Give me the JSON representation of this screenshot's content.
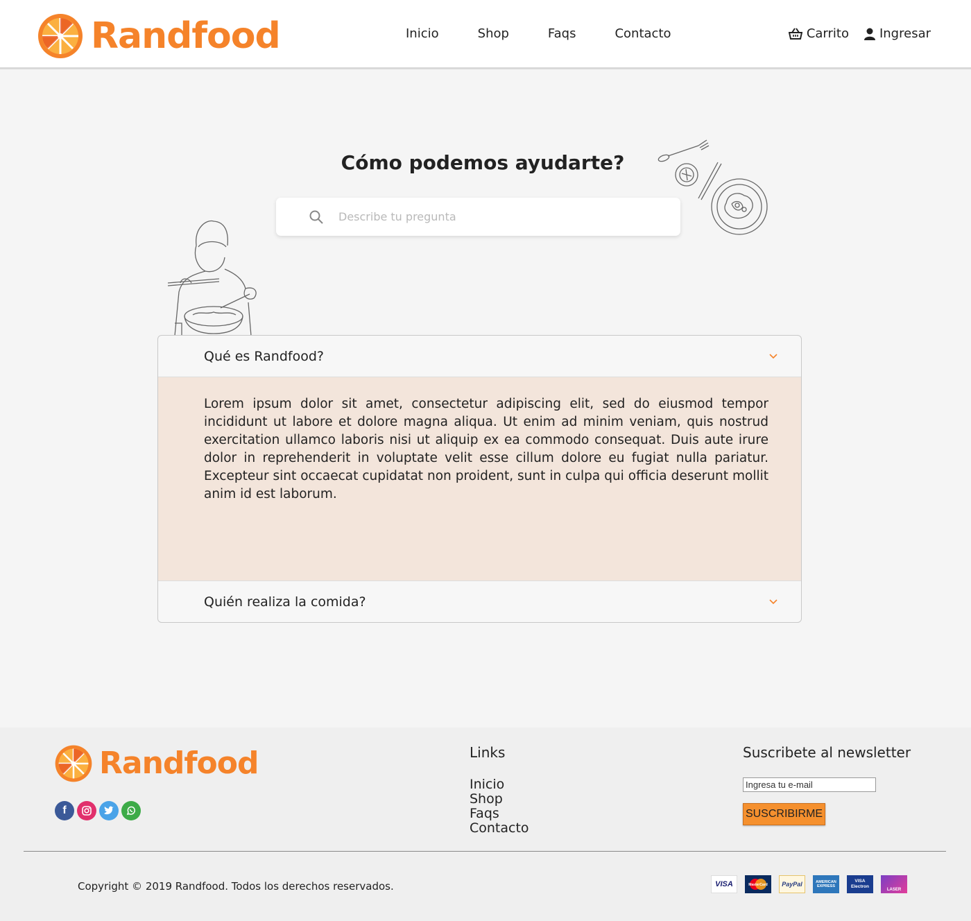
{
  "brand": {
    "name": "Randfood",
    "orange": "#f5832a"
  },
  "nav": {
    "items": [
      "Inicio",
      "Shop",
      "Faqs",
      "Contacto"
    ]
  },
  "header": {
    "cart_label": "Carrito",
    "login_label": "Ingresar"
  },
  "hero": {
    "title": "Cómo podemos ayudarte?",
    "search_placeholder": "Describe tu pregunta"
  },
  "faq": {
    "items": [
      {
        "question": "Qué es Randfood?",
        "answer": "Lorem ipsum dolor sit amet, consectetur adipiscing elit, sed do eiusmod tempor incididunt ut labore et dolore magna aliqua. Ut enim ad minim veniam, quis nostrud exercitation ullamco laboris nisi ut aliquip ex ea commodo consequat. Duis aute irure dolor in reprehenderit in voluptate velit esse cillum dolore eu fugiat nulla pariatur. Excepteur sint occaecat cupidatat non proident, sunt in culpa qui officia deserunt mollit anim id est laborum.",
        "expanded": true
      },
      {
        "question": "Quién realiza la comida?",
        "expanded": false
      }
    ]
  },
  "footer": {
    "links_title": "Links",
    "links": [
      "Inicio",
      "Shop",
      "Faqs",
      "Contacto"
    ],
    "newsletter_title": "Suscribete al newsletter",
    "email_placeholder": "Ingresa tu e-mail",
    "subscribe_label": "SUSCRIBIRME",
    "copyright": "Copyright © 2019 Randfood. Todos los derechos reservados.",
    "social": [
      "facebook-icon",
      "instagram-icon",
      "twitter-icon",
      "whatsapp-icon"
    ],
    "payments": [
      "VISA",
      "MasterCard",
      "PayPal",
      "AMERICAN EXPRESS",
      "VISA Electron",
      "LASER"
    ]
  }
}
